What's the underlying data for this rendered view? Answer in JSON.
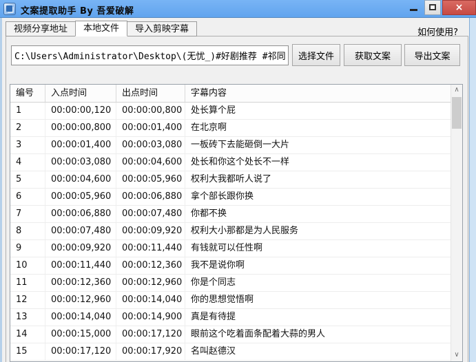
{
  "window": {
    "title": "文案提取助手 By 吾爱破解"
  },
  "icons": {
    "close": "×",
    "scroll_up": "∧",
    "scroll_down": "∨"
  },
  "tabs": [
    {
      "label": "视频分享地址",
      "active": false
    },
    {
      "label": "本地文件",
      "active": true
    },
    {
      "label": "导入剪映字幕",
      "active": false
    }
  ],
  "help_link": "如何使用?",
  "toolbar": {
    "path_value": "C:\\Users\\Administrator\\Desktop\\(无忧_)#好剧推荐 #祁同伟 #因为一个",
    "select_file_label": "选择文件",
    "get_text_label": "获取文案",
    "export_text_label": "导出文案"
  },
  "table": {
    "headers": [
      "编号",
      "入点时间",
      "出点时间",
      "字幕内容"
    ],
    "rows": [
      [
        "1",
        "00:00:00,120",
        "00:00:00,800",
        "处长算个屁"
      ],
      [
        "2",
        "00:00:00,800",
        "00:00:01,400",
        "在北京啊"
      ],
      [
        "3",
        "00:00:01,400",
        "00:00:03,080",
        "一板砖下去能砸倒一大片"
      ],
      [
        "4",
        "00:00:03,080",
        "00:00:04,600",
        "处长和你这个处长不一样"
      ],
      [
        "5",
        "00:00:04,600",
        "00:00:05,960",
        "权利大我都听人说了"
      ],
      [
        "6",
        "00:00:05,960",
        "00:00:06,880",
        "拿个部长跟你换"
      ],
      [
        "7",
        "00:00:06,880",
        "00:00:07,480",
        "你都不换"
      ],
      [
        "8",
        "00:00:07,480",
        "00:00:09,920",
        "权利大小那都是为人民服务"
      ],
      [
        "9",
        "00:00:09,920",
        "00:00:11,440",
        "有钱就可以任性啊"
      ],
      [
        "10",
        "00:00:11,440",
        "00:00:12,360",
        "我不是说你啊"
      ],
      [
        "11",
        "00:00:12,360",
        "00:00:12,960",
        "你是个同志"
      ],
      [
        "12",
        "00:00:12,960",
        "00:00:14,040",
        "你的思想觉悟啊"
      ],
      [
        "13",
        "00:00:14,040",
        "00:00:14,900",
        "真是有待提"
      ],
      [
        "14",
        "00:00:15,000",
        "00:00:17,120",
        "眼前这个吃着面条配着大蒜的男人"
      ],
      [
        "15",
        "00:00:17,120",
        "00:00:17,920",
        "名叫赵德汉"
      ]
    ]
  },
  "colors": {
    "titlebar": "#6babf3",
    "close_button": "#c74a44",
    "window_bg": "#f0f0f0",
    "frame": "#cfe3f5"
  }
}
